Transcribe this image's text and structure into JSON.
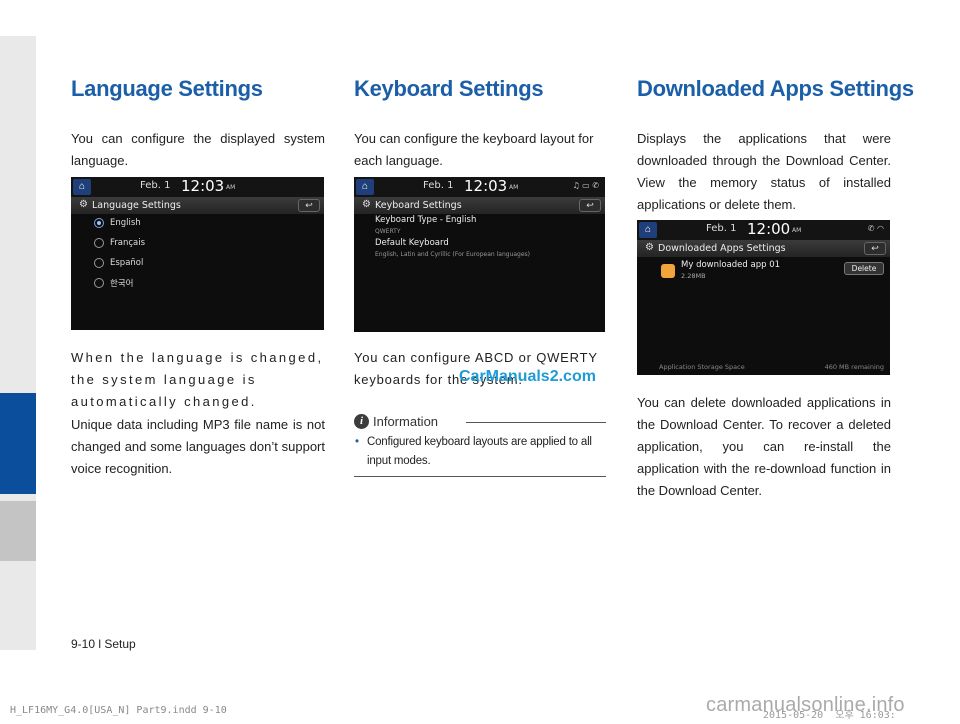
{
  "sections": {
    "language": {
      "title": "Language Settings",
      "intro": "You can configure the displayed system language.",
      "screen": {
        "date": "Feb.   1",
        "time": "12:03",
        "ampm": "AM",
        "title": "Language Settings",
        "options": [
          {
            "label": "English",
            "selected": true
          },
          {
            "label": "Français",
            "selected": false
          },
          {
            "label": "Español",
            "selected": false
          },
          {
            "label": "한국어",
            "selected": false
          }
        ]
      },
      "para2": "When the language is changed, the system language is automatically changed.",
      "para3": "Unique data including MP3 file name is not changed and some languages don’t support voice recognition."
    },
    "keyboard": {
      "title": "Keyboard Settings",
      "intro": "You can configure the keyboard layout for each language.",
      "screen": {
        "date": "Feb.   1",
        "time": "12:03",
        "ampm": "AM",
        "title": "Keyboard Settings",
        "item1_title": "Keyboard Type - English",
        "item1_sub": "QWERTY",
        "item2_title": "Default Keyboard",
        "item2_sub": "English, Latin and Cyrillic (For European languages)"
      },
      "para2": "You can configure ABCD or QWERTY keyboards for the system.",
      "info_title": "Information",
      "info_bullet": "Configured keyboard layouts are applied to all input modes."
    },
    "apps": {
      "title": "Downloaded Apps Settings",
      "intro": "Displays the applications that were downloaded through the Download Center. View the memory status of installed applications or delete them.",
      "screen": {
        "date": "Feb.   1",
        "time": "12:00",
        "ampm": "AM",
        "title": "Downloaded Apps Settings",
        "app_name": "My downloaded app 01",
        "app_size": "2.28MB",
        "delete_label": "Delete",
        "storage_label": "Application Storage Space",
        "remaining": "460 MB remaining"
      },
      "para2": "You can delete downloaded applications in the Download Center. To recover a deleted application, you can re-install the application with the re-download function in the Download Center."
    }
  },
  "watermark": "CarManuals2.com",
  "footer": "9-10 l Setup",
  "print_line": "H_LF16MY_G4.0[USA_N] Part9.indd   9-10",
  "print_date": "2015-05-20    오후 16:03:",
  "site_watermark": "carmanualsonline.info"
}
